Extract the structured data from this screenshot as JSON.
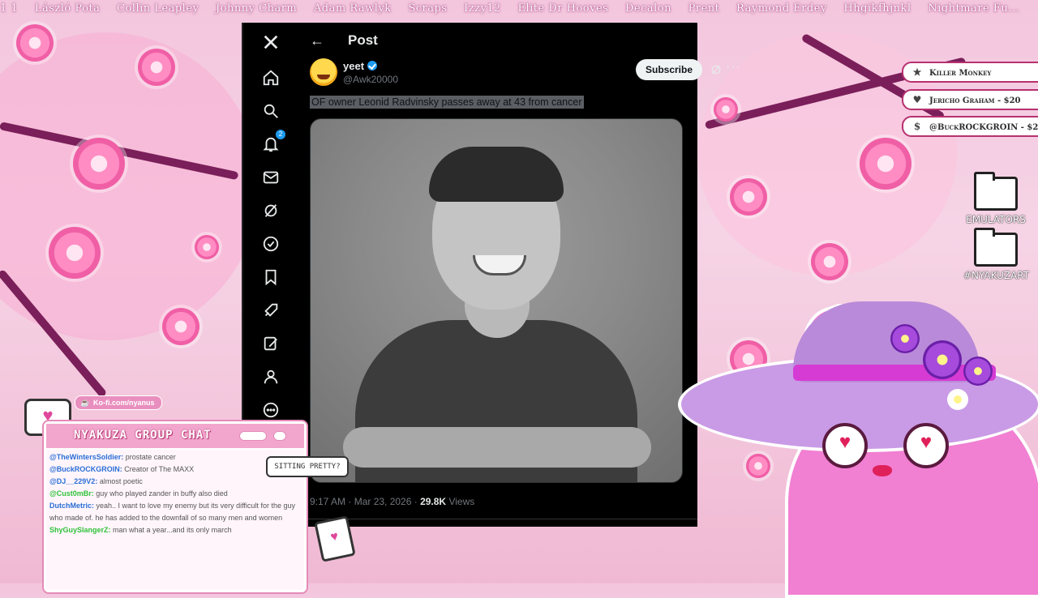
{
  "ticker": [
    "1 1",
    "László Pota",
    "Collin Leapley",
    "Johnny Charm",
    "Adam Rawlyk",
    "Scraps",
    "Izzy12",
    "Elite Dr Hooves",
    "Decalon",
    "Prent",
    "Raymond Erdey",
    "Hhgikfhjnkl",
    "Nightmare Fu..."
  ],
  "x": {
    "nav": [
      {
        "name": "x-logo-icon",
        "label": ""
      },
      {
        "name": "home-icon"
      },
      {
        "name": "explore-icon"
      },
      {
        "name": "notifications-icon",
        "badge": "2"
      },
      {
        "name": "messages-icon"
      },
      {
        "name": "grok-icon"
      },
      {
        "name": "premium-icon"
      },
      {
        "name": "bookmarks-icon"
      },
      {
        "name": "jobs-icon"
      },
      {
        "name": "compose-icon"
      },
      {
        "name": "profile-icon"
      },
      {
        "name": "more-icon"
      }
    ],
    "header": {
      "back": "←",
      "title": "Post"
    },
    "tweet": {
      "display_name": "yeet",
      "handle": "@Awk20000",
      "subscribe_label": "Subscribe",
      "more": "···",
      "text": "OF owner Leonid Radvinsky passes away at 43 from cancer",
      "time": "9:17 AM · Mar 23, 2026 · ",
      "views_count": "29.8K",
      "views_label": " Views"
    }
  },
  "alerts": [
    {
      "icon": "★",
      "text": "Killer Monkey"
    },
    {
      "icon": "♥",
      "text": "Jericho Graham - $20"
    },
    {
      "icon": "$",
      "text": "@BuckROCKGROIN - $2"
    }
  ],
  "folders": [
    "EMULATORS",
    "#NYAKUZART"
  ],
  "chat": {
    "kofi": "Ko-fi.com/nyanus",
    "title": "NYAKUZA GROUP CHAT",
    "messages": [
      {
        "user": "@TheWintersSoldier:",
        "text": " prostate cancer",
        "green": false
      },
      {
        "user": "@BuckROCKGROIN:",
        "text": " Creator of The MAXX",
        "green": false
      },
      {
        "user": "@DJ__229V2:",
        "text": " almost poetic",
        "green": false
      },
      {
        "user": "@Cust0mBr:",
        "text": " guy who played zander in buffy also died",
        "green": true
      },
      {
        "user": "DutchMetric:",
        "text": " yeah.. I want to love my enemy but its very difficult for the guy who made of. he has added to the downfall of so many men and women",
        "green": false
      },
      {
        "user": "ShyGuySlangerZ:",
        "text": " man what a year...and its only march",
        "green": true
      }
    ]
  },
  "overlay": {
    "sitting": "SITTING PRETTY?"
  }
}
